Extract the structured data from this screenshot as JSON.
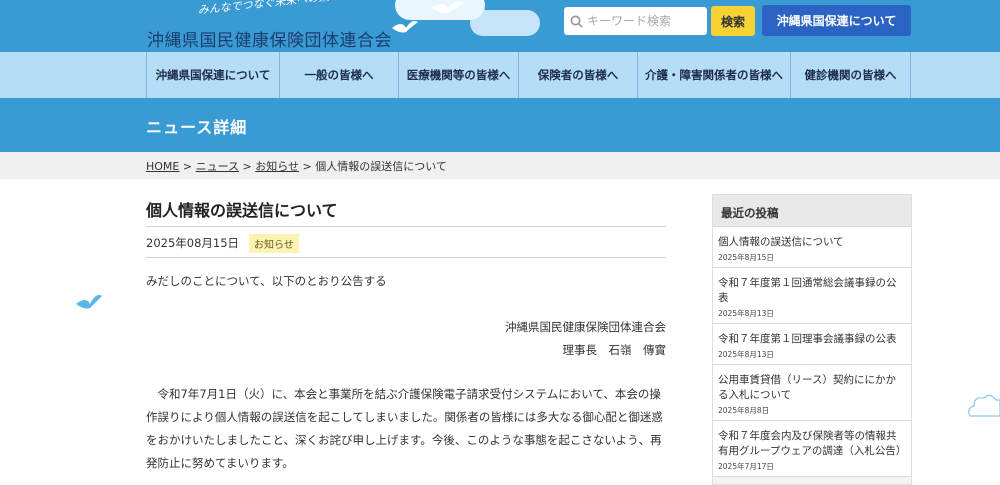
{
  "header": {
    "tagline": "みんなでつなぐ未来への架け橋",
    "org_title": "沖縄県国民健康保険団体連合会",
    "search_placeholder": "キーワード検索",
    "search_button": "検索",
    "about_button": "沖縄県国保連について"
  },
  "nav": {
    "items": [
      {
        "label": "沖縄県国保連について"
      },
      {
        "label": "一般の皆様へ"
      },
      {
        "label": "医療機関等の皆様へ"
      },
      {
        "label": "保険者の皆様へ"
      },
      {
        "label": "介護・障害関係者の皆様へ"
      },
      {
        "label": "健診機関の皆様へ"
      }
    ]
  },
  "page_title": "ニュース詳細",
  "breadcrumb": {
    "home": "HOME",
    "news": "ニュース",
    "notice": "お知らせ",
    "current": "個人情報の誤送信について",
    "separator": ">"
  },
  "article": {
    "title": "個人情報の誤送信について",
    "date": "2025年08月15日",
    "tag": "お知らせ",
    "lead": "みだしのことについて、以下のとおり公告する",
    "signature_org": "沖縄県国民健康保険団体連合会",
    "signature_person": "理事長　石嶺　傳實",
    "body": "令和7年7月1日（火）に、本会と事業所を結ぶ介護保険電子請求受付システムにおいて、本会の操作誤りにより個人情報の誤送信を起こしてしまいました。関係者の皆様には多大なる御心配と御迷惑をおかけいたしましたこと、深くお詫び申し上げます。今後、このような事態を起こさないよう、再発防止に努めてまいります。"
  },
  "sidebar": {
    "heading": "最近の投稿",
    "posts": [
      {
        "title": "個人情報の誤送信について",
        "date": "2025年8月15日"
      },
      {
        "title": "令和７年度第１回通常総会議事録の公表",
        "date": "2025年8月13日"
      },
      {
        "title": "令和７年度第１回理事会議事録の公表",
        "date": "2025年8月13日"
      },
      {
        "title": "公用車賃貸借（リース）契約ににかかる入札について",
        "date": "2025年8月8日"
      },
      {
        "title": "令和７年度会内及び保険者等の情報共有用グループウェアの調達（入札公告）",
        "date": "2025年7月17日"
      }
    ]
  },
  "colors": {
    "header_blue": "#3a9ad4",
    "nav_light_blue": "#b6ddf6",
    "search_yellow": "#f7d234",
    "about_dark_blue": "#2a63c4"
  }
}
